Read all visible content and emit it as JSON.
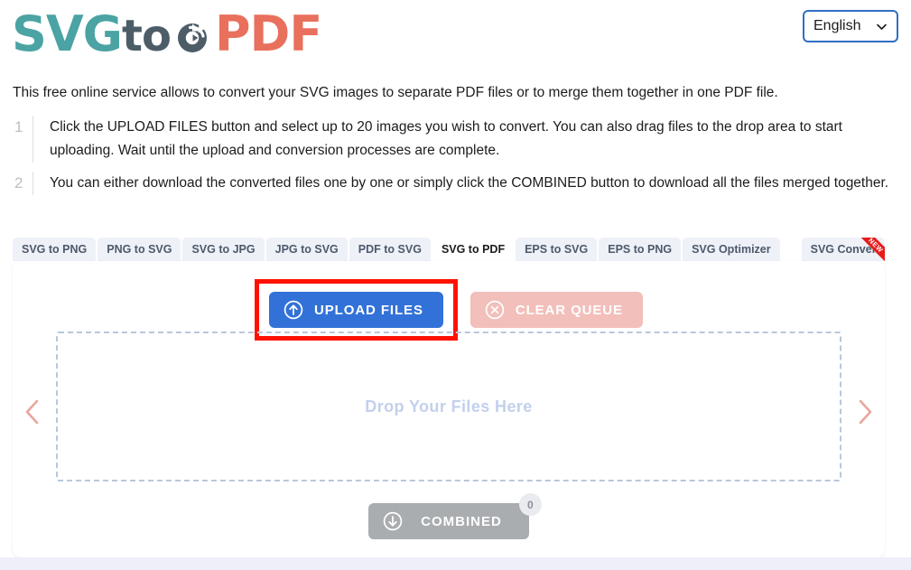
{
  "header": {
    "logo": {
      "part1": "SVG",
      "part2": "to",
      "part3": "PDF",
      "arrow_icon": "circular-refresh-arrow-icon"
    },
    "language": {
      "value": "English",
      "chevron_icon": "chevron-down-icon"
    }
  },
  "intro": {
    "description": "This free online service allows to convert your SVG images to separate PDF files or to merge them together in one PDF file."
  },
  "steps": [
    {
      "number": "1",
      "text": "Click the UPLOAD FILES button and select up to 20 images you wish to convert. You can also drag files to the drop area to start uploading. Wait until the upload and conversion processes are complete."
    },
    {
      "number": "2",
      "text": "You can either download the converted files one by one or simply click the COMBINED button to download all the files merged together."
    }
  ],
  "tabs": [
    {
      "label": "SVG to PNG",
      "active": false
    },
    {
      "label": "PNG to SVG",
      "active": false
    },
    {
      "label": "SVG to JPG",
      "active": false
    },
    {
      "label": "JPG to SVG",
      "active": false
    },
    {
      "label": "PDF to SVG",
      "active": false
    },
    {
      "label": "SVG to PDF",
      "active": true
    },
    {
      "label": "EPS to SVG",
      "active": false
    },
    {
      "label": "EPS to PNG",
      "active": false
    },
    {
      "label": "SVG Optimizer",
      "active": false
    },
    {
      "label": "SVG Converter",
      "active": false,
      "ribbon": "NEW"
    }
  ],
  "card": {
    "upload_button": {
      "label": "UPLOAD FILES",
      "icon": "upload-circle-arrow-icon"
    },
    "clear_button": {
      "label": "CLEAR QUEUE",
      "icon": "close-circle-icon"
    },
    "dropzone": {
      "text": "Drop Your Files Here"
    },
    "prev_arrow": {
      "icon": "chevron-left-icon",
      "glyph": "‹"
    },
    "next_arrow": {
      "icon": "chevron-right-icon",
      "glyph": "›"
    },
    "combined_button": {
      "label": "COMBINED",
      "icon": "download-circle-arrow-icon",
      "count": "0"
    }
  },
  "colors": {
    "logo_teal": "#4ba3a3",
    "logo_slate": "#4d5d68",
    "logo_coral": "#e8705d",
    "upload_blue": "#3272d8",
    "clear_pink": "#f2bfbb",
    "combined_gray": "#a9adb0",
    "highlight_red": "#ff1100",
    "tab_bg": "#eef1f8",
    "dropzone_border": "#b9c7dd",
    "drop_text": "#c3d0ec",
    "nav_arrow": "#e8a79c",
    "lang_border": "#2f6fc4"
  }
}
